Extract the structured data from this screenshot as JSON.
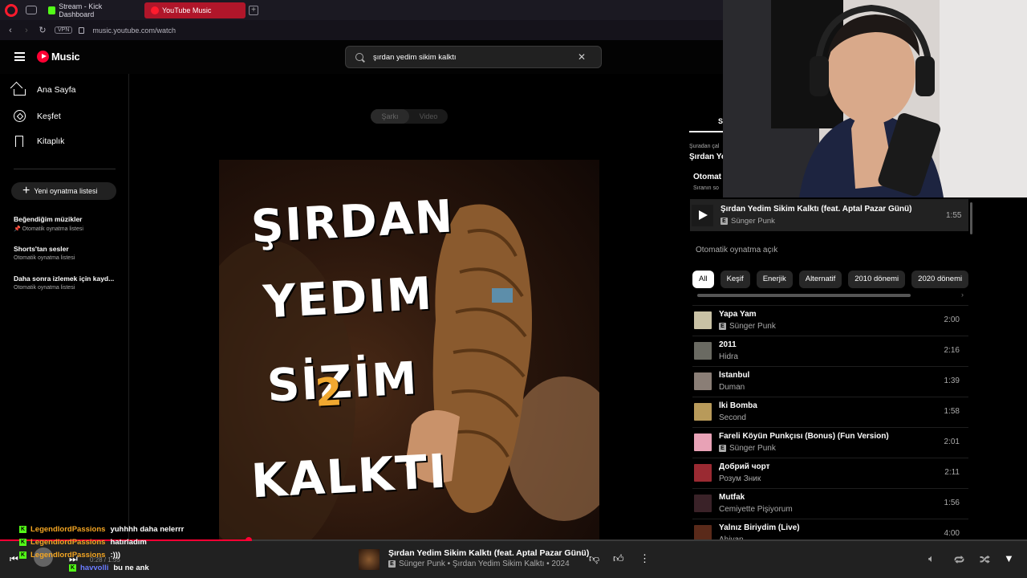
{
  "browser": {
    "tabs": [
      {
        "label": "Stream - Kick Dashboard",
        "active": false
      },
      {
        "label": "YouTube Music",
        "active": true
      }
    ],
    "vpn_label": "VPN",
    "url": "music.youtube.com/watch"
  },
  "header": {
    "logo_text": "Music",
    "search_value": "şırdan yedim sikim kalktı"
  },
  "sidebar": {
    "nav": [
      {
        "label": "Ana Sayfa",
        "icon": "home-icon"
      },
      {
        "label": "Keşfet",
        "icon": "compass-icon"
      },
      {
        "label": "Kitaplık",
        "icon": "library-icon"
      }
    ],
    "new_playlist": "Yeni oynatma listesi",
    "playlists": [
      {
        "title": "Beğendiğim müzikler",
        "sub": "Otomatik oynatma listesi",
        "pinned": true
      },
      {
        "title": "Shorts'tan sesler",
        "sub": "Otomatik oynatma listesi",
        "pinned": false
      },
      {
        "title": "Daha sonra izlemek için kayd...",
        "sub": "Otomatik oynatma listesi",
        "pinned": false
      }
    ]
  },
  "main": {
    "toggle": {
      "song": "Şarkı",
      "video": "Video"
    },
    "art_lines": [
      "ŞIRDAN",
      "YEDIM",
      "SİZİM",
      "KALKTI"
    ],
    "art_digit": "2"
  },
  "queue": {
    "tab_initial": "S",
    "playing_from_label": "Şuradan çal",
    "playing_from_title": "Şırdan Ye",
    "section_title": "Otomat",
    "section_sub": "Sıranın so",
    "current": {
      "title": "Şırdan Yedim Sikim Kalktı (feat. Aptal Pazar Günü)",
      "artist": "Sünger Punk",
      "duration": "1:55"
    },
    "autoplay": "Otomatik oynatma açık",
    "chips": [
      "All",
      "Keşif",
      "Enerjik",
      "Alternatif",
      "2010 dönemi",
      "2020 dönemi"
    ],
    "items": [
      {
        "title": "Yapa Yam",
        "artist": "Sünger Punk",
        "explicit": true,
        "duration": "2:00",
        "thumb": "#c9c2a5"
      },
      {
        "title": "2011",
        "artist": "Hidra",
        "explicit": false,
        "duration": "2:16",
        "thumb": "#6a6a62"
      },
      {
        "title": "İstanbul",
        "artist": "Duman",
        "explicit": false,
        "duration": "1:39",
        "thumb": "#8a7e76"
      },
      {
        "title": "İki Bomba",
        "artist": "Second",
        "explicit": false,
        "duration": "1:58",
        "thumb": "#b89a5a"
      },
      {
        "title": "Fareli Köyün Punkçısı (Bonus) (Fun Version)",
        "artist": "Sünger Punk",
        "explicit": true,
        "duration": "2:01",
        "thumb": "#e8a2b6"
      },
      {
        "title": "Добрий чорт",
        "artist": "Розум Зник",
        "explicit": false,
        "duration": "2:11",
        "thumb": "#9a2a32"
      },
      {
        "title": "Mutfak",
        "artist": "Cemiyette Pişiyorum",
        "explicit": false,
        "duration": "1:56",
        "thumb": "#3a2228"
      },
      {
        "title": "Yalnız Biriydim (Live)",
        "artist": "Ahiyan",
        "explicit": false,
        "duration": "4:00",
        "thumb": "#5a2a1a"
      }
    ]
  },
  "player": {
    "progress_fraction": 0.242,
    "time": "0:28 / 1:55",
    "title": "Şırdan Yedim Sikim Kalktı (feat. Aptal Pazar Günü)",
    "sub": "Sünger Punk • Şırdan Yedim Sikim Kalktı • 2024",
    "accent": "#ff0033"
  },
  "chat": [
    {
      "user": "LegendlordPassions",
      "msg": "yuhhhh daha nelerrr",
      "color": "orange"
    },
    {
      "user": "LegendlordPassions",
      "msg": "hatırladım",
      "color": "orange"
    },
    {
      "user": "LegendlordPassions",
      "msg": ":)))",
      "color": "orange"
    },
    {
      "user": "havvolli",
      "msg": "bu ne ank",
      "color": "blue"
    }
  ]
}
